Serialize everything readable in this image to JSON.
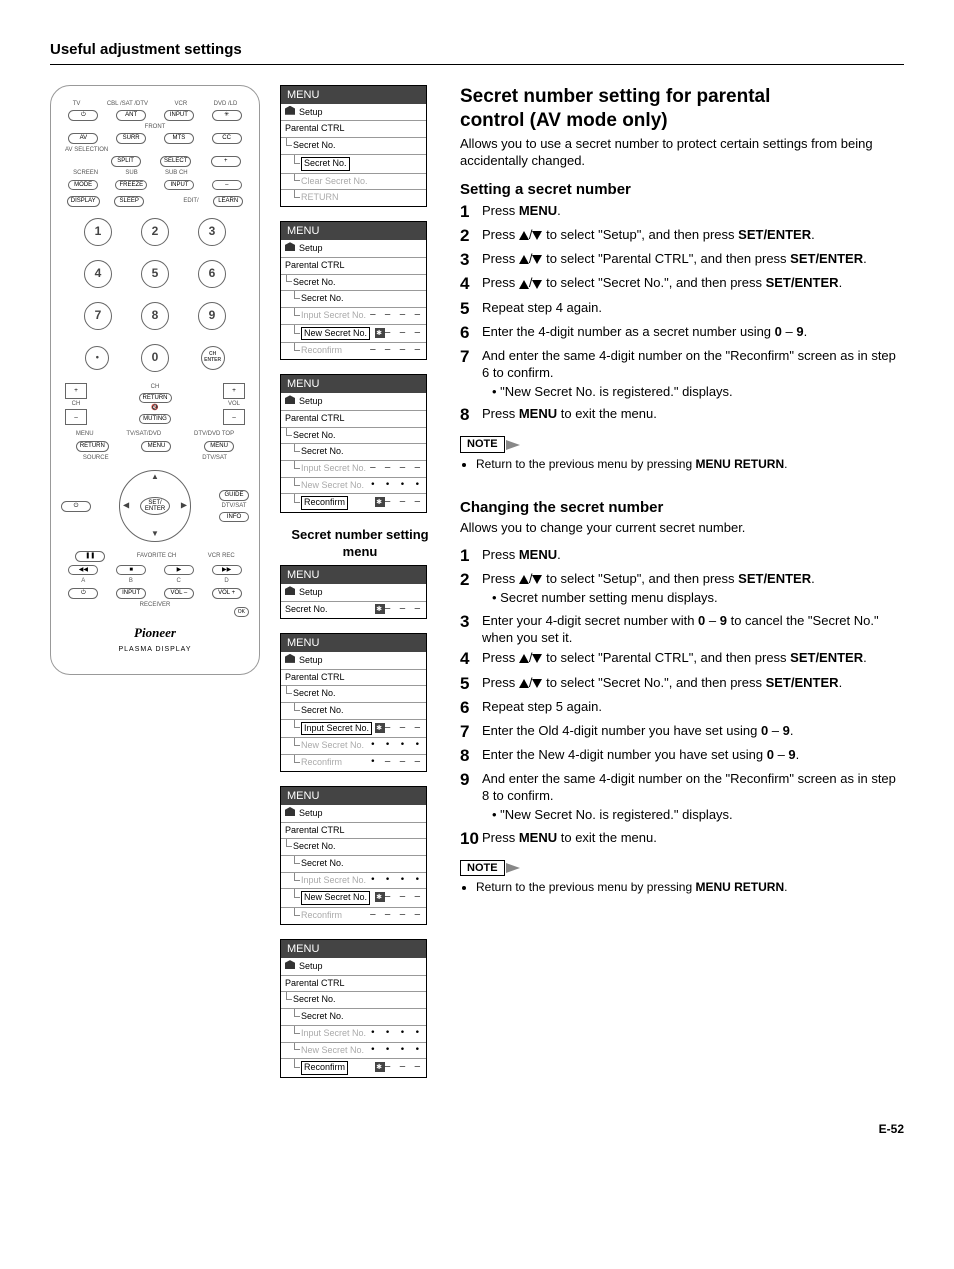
{
  "page_header": "Useful adjustment settings",
  "page_number": "E-52",
  "remote": {
    "top_labels": [
      "TV",
      "CBL /SAT /DTV",
      "VCR",
      "DVD /LD"
    ],
    "front_label": "FRONT",
    "av_sel_label": "AV SELECTION",
    "screen_label": "SCREEN",
    "sub_label": "SUB",
    "subch_label": "SUB CH",
    "btn_ant": "ANT",
    "btn_input": "INPUT",
    "btn_light": "✳",
    "btn_surr": "SURR",
    "btn_mts": "MTS",
    "btn_cc": "CC",
    "btn_split": "SPLIT",
    "btn_select": "SELECT",
    "btn_plus": "+",
    "btn_mode": "MODE",
    "btn_freeze": "FREEZE",
    "btn_input2": "INPUT",
    "btn_minus": "–",
    "btn_display": "DISPLAY",
    "btn_sleep": "SLEEP",
    "btn_edit": "EDIT/",
    "btn_learn": "LEARN",
    "ch_label": "CH",
    "return_label": "RETURN",
    "vol_label": "VOL",
    "muting_label": "MUTING",
    "ch_enter": "CH ENTER",
    "menu_label": "MENU",
    "tvsatdvd_label": "TV/SAT/DVD",
    "dtvdvdtop_label": "DTV/DVD TOP",
    "btn_return": "RETURN",
    "btn_menu": "MENU",
    "source_label": "SOURCE",
    "dtvsat_label": "DTV/SAT",
    "guide_label": "GUIDE",
    "info_label": "INFO",
    "set_enter": "SET/ ENTER",
    "favorite_label": "FAVORITE CH",
    "vcr_rec": "VCR REC",
    "abcd": [
      "A",
      "B",
      "C",
      "D"
    ],
    "receiver_label": "RECEIVER",
    "volminus": "VOL –",
    "volplus": "VOL +",
    "ok_label": "OK",
    "brand": "Pioneer",
    "model": "PLASMA DISPLAY"
  },
  "menus": {
    "title": "MENU",
    "setup_label": "Setup",
    "parental": "Parental CTRL",
    "secret_no": "Secret No.",
    "clear_secret": "Clear Secret No.",
    "return": "RETURN",
    "input_secret": "Input Secret No.",
    "new_secret": "New Secret No.",
    "reconfirm": "Reconfirm",
    "caption": "Secret number setting menu",
    "dashes": "– – – –",
    "dots": "• • • •",
    "star_dash": "– – –",
    "star": "✱"
  },
  "right": {
    "h1a": "Secret number setting for parental",
    "h1b": "control (AV mode only)",
    "intro1": "Allows you to use a secret number to protect certain settings from being accidentally changed.",
    "sub1": "Setting a secret number",
    "s1_1_pre": "Press ",
    "s1_1_b": "MENU",
    "s1_1_post": ".",
    "s1_2_a": "Press ",
    "s1_2_b": " to select \"Setup\", and then press ",
    "s1_2_c": "SET/ENTER",
    "s1_2_d": ".",
    "s1_3_a": "Press ",
    "s1_3_b": " to select \"Parental CTRL\", and then press ",
    "s1_3_c": "SET/ENTER",
    "s1_3_d": ".",
    "s1_4_a": "Press ",
    "s1_4_b": " to select \"Secret No.\", and then press ",
    "s1_4_c": "SET/ENTER",
    "s1_4_d": ".",
    "s1_5": "Repeat step 4 again.",
    "s1_6_a": "Enter the 4-digit number as a secret number using ",
    "s1_6_b": "0",
    "s1_6_c": " – ",
    "s1_6_d": "9",
    "s1_6_e": ".",
    "s1_7": "And enter the same 4-digit number on the \"Reconfirm\" screen as in step 6 to confirm.",
    "s1_7_sub": "\"New Secret No. is registered.\" displays.",
    "s1_8_a": "Press ",
    "s1_8_b": "MENU",
    "s1_8_c": " to exit the menu.",
    "note_label": "NOTE",
    "note1_a": "Return to the previous menu by pressing ",
    "note1_b": "MENU RETURN",
    "note1_c": ".",
    "sub2": "Changing the secret number",
    "intro2": "Allows you to change your current secret number.",
    "s2_1_a": "Press ",
    "s2_1_b": "MENU",
    "s2_1_c": ".",
    "s2_2_a": "Press ",
    "s2_2_b": " to select \"Setup\", and then press ",
    "s2_2_c": "SET/ENTER",
    "s2_2_d": ".",
    "s2_2_sub": "Secret number setting menu displays.",
    "s2_3_a": "Enter your 4-digit secret number with ",
    "s2_3_b": "0",
    "s2_3_c": " – ",
    "s2_3_d": "9",
    "s2_3_e": " to cancel the \"Secret No.\" when you set it.",
    "s2_4_a": "Press ",
    "s2_4_b": " to select \"Parental CTRL\", and then press ",
    "s2_4_c": "SET/ENTER",
    "s2_4_d": ".",
    "s2_5_a": "Press ",
    "s2_5_b": " to select \"Secret No.\", and then press ",
    "s2_5_c": "SET/ENTER",
    "s2_5_d": ".",
    "s2_6": "Repeat step 5 again.",
    "s2_7_a": "Enter the Old 4-digit number you have set using ",
    "s2_7_b": "0",
    "s2_7_c": " – ",
    "s2_7_d": "9",
    "s2_7_e": ".",
    "s2_8_a": "Enter the New 4-digit number you have set using ",
    "s2_8_b": "0",
    "s2_8_c": " – ",
    "s2_8_d": "9",
    "s2_8_e": ".",
    "s2_9": "And enter the same 4-digit number on the \"Reconfirm\" screen as in step 8 to confirm.",
    "s2_9_sub": "\"New Secret No. is registered.\" displays.",
    "s2_10_a": "Press ",
    "s2_10_b": "MENU",
    "s2_10_c": " to exit the menu."
  }
}
